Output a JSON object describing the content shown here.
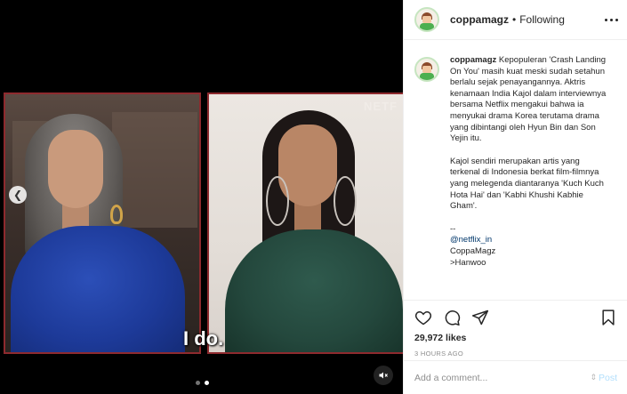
{
  "post": {
    "username": "coppamagz",
    "separator": "•",
    "follow_status": "Following",
    "caption_user": "coppamagz",
    "caption_paragraph_1": "Kepopuleran 'Crash Landing On You' masih kuat meski sudah setahun berlalu sejak penayangannya. Aktris kenamaan India Kajol dalam interviewnya bersama Netflix mengakui bahwa ia menyukai drama Korea terutama drama yang dibintangi oleh Hyun Bin dan Son Yejin itu.",
    "caption_paragraph_2": "Kajol sendiri merupakan artis yang terkenal di Indonesia berkat film-filmnya yang melegenda diantaranya 'Kuch Kuch Hota Hai' dan 'Kabhi Khushi Kabhie Gham'.",
    "caption_dashes": "--",
    "caption_mention": "@netflix_in",
    "caption_credit_1": "CoppaMagz",
    "caption_credit_2": ">Hanwoo",
    "likes": "29,972 likes",
    "timestamp": "3 HOURS AGO"
  },
  "media": {
    "subtitle": "I do.",
    "watermark": "NETF",
    "carousel_count": 2,
    "carousel_active": 1
  },
  "comment_box": {
    "placeholder": "Add a comment...",
    "post_label": "Post"
  },
  "icons": {
    "like": "heart-icon",
    "comment": "comment-icon",
    "share": "send-icon",
    "save": "bookmark-icon",
    "more": "more-options-icon",
    "mute": "mute-icon",
    "prev": "chevron-left-icon"
  },
  "colors": {
    "frame_border": "#8e2a2e",
    "link": "#00376b",
    "post_disabled": "#b2dffc",
    "muted_text": "#8e8e8e"
  }
}
